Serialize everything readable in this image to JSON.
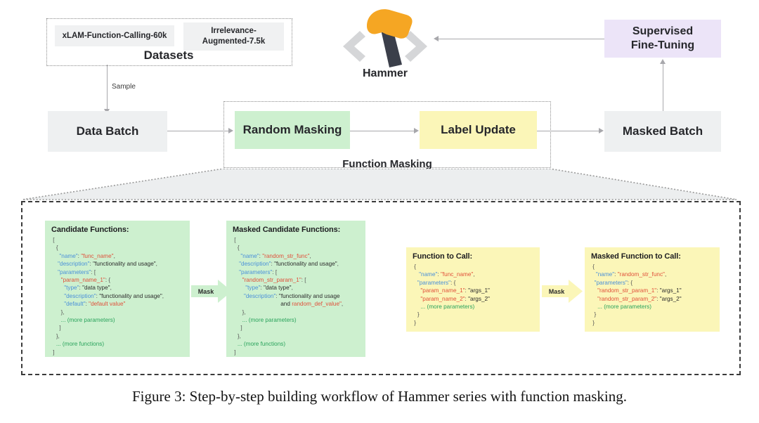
{
  "figure": {
    "caption": "Figure 3: Step-by-step building workflow of Hammer series with function masking."
  },
  "logo": {
    "name": "Hammer",
    "head_color": "#f5a623",
    "handle_color": "#3b3f4a",
    "bracket_color": "#d5d6d8"
  },
  "datasets_group": {
    "label": "Datasets",
    "items": [
      {
        "label": "xLAM-Function-Calling-60k"
      },
      {
        "label": "Irrelevance-\nAugmented-7.5k"
      }
    ]
  },
  "pipeline": {
    "sample_label": "Sample",
    "data_batch": {
      "label": "Data Batch",
      "color": "#eef0f1"
    },
    "random_masking": {
      "label": "Random Masking",
      "color": "#cdf0cf"
    },
    "label_update": {
      "label": "Label Update",
      "color": "#fbf6b8"
    },
    "masked_batch": {
      "label": "Masked Batch",
      "color": "#eef0f1"
    },
    "function_masking_label": "Function Masking",
    "supervised_fine_tuning": {
      "label": "Supervised\nFine-Tuning",
      "color": "#ece4f8"
    }
  },
  "detail": {
    "mask_arrow_1_label": "Mask",
    "mask_arrow_2_label": "Mask",
    "candidate_functions": {
      "title": "Candidate Functions:",
      "color": "#cdf0cf",
      "lines": [
        [
          [
            "b",
            " ["
          ]
        ],
        [
          [
            "b",
            "   {"
          ]
        ],
        [
          [
            "b",
            "     "
          ],
          [
            "k",
            "\"name\""
          ],
          [
            "b",
            ": "
          ],
          [
            "s",
            "\"func_name\""
          ],
          [
            "b",
            ","
          ]
        ],
        [
          [
            "b",
            "    "
          ],
          [
            "k",
            "\"description\""
          ],
          [
            "b",
            ": "
          ],
          [
            "p",
            "\"functionality and usage\""
          ],
          [
            "b",
            ","
          ]
        ],
        [
          [
            "b",
            "    "
          ],
          [
            "k",
            "\"parameters\""
          ],
          [
            "b",
            ": ["
          ]
        ],
        [
          [
            "b",
            "      "
          ],
          [
            "s",
            "\"param_name_1\""
          ],
          [
            "b",
            ": {"
          ]
        ],
        [
          [
            "b",
            "        "
          ],
          [
            "k",
            "\"type\""
          ],
          [
            "b",
            ": "
          ],
          [
            "p",
            "\"data type\""
          ],
          [
            "b",
            ","
          ]
        ],
        [
          [
            "b",
            "        "
          ],
          [
            "k",
            "\"description\""
          ],
          [
            "b",
            ": "
          ],
          [
            "p",
            "\"functionality and usage\""
          ],
          [
            "b",
            ","
          ]
        ],
        [
          [
            "b",
            "        "
          ],
          [
            "k",
            "\"default\""
          ],
          [
            "b",
            ": "
          ],
          [
            "s",
            "\"default value\""
          ]
        ],
        [
          [
            "b",
            "      },"
          ]
        ],
        [
          [
            "b",
            "      "
          ],
          [
            "g",
            "... (more parameters)"
          ]
        ],
        [
          [
            "b",
            "     ]"
          ]
        ],
        [
          [
            "b",
            "   },"
          ]
        ],
        [
          [
            "b",
            "   "
          ],
          [
            "g",
            "... (more functions)"
          ]
        ],
        [
          [
            "b",
            " ]"
          ]
        ]
      ]
    },
    "masked_candidate_functions": {
      "title": "Masked Candidate Functions:",
      "color": "#cdf0cf",
      "lines": [
        [
          [
            "b",
            " ["
          ]
        ],
        [
          [
            "b",
            "   {"
          ]
        ],
        [
          [
            "b",
            "     "
          ],
          [
            "k",
            "\"name\""
          ],
          [
            "b",
            ": "
          ],
          [
            "s",
            "\"random_str_func\""
          ],
          [
            "b",
            ","
          ]
        ],
        [
          [
            "b",
            "    "
          ],
          [
            "k",
            "\"description\""
          ],
          [
            "b",
            ": "
          ],
          [
            "p",
            "\"functionality and usage\""
          ],
          [
            "b",
            ","
          ]
        ],
        [
          [
            "b",
            "    "
          ],
          [
            "k",
            "\"parameters\""
          ],
          [
            "b",
            ": ["
          ]
        ],
        [
          [
            "b",
            "      "
          ],
          [
            "s",
            "\"random_str_param_1\""
          ],
          [
            "b",
            ": ["
          ]
        ],
        [
          [
            "b",
            "        "
          ],
          [
            "k",
            "\"type\""
          ],
          [
            "b",
            ": "
          ],
          [
            "p",
            "\"data type\""
          ],
          [
            "b",
            ","
          ]
        ],
        [
          [
            "b",
            "       "
          ],
          [
            "k",
            "\"description\""
          ],
          [
            "b",
            ": "
          ],
          [
            "p",
            "\"functionality and usage"
          ]
        ],
        [
          [
            "b",
            "                              "
          ],
          [
            "p",
            "and "
          ],
          [
            "s",
            "random_def_value\""
          ],
          [
            "b",
            ","
          ]
        ],
        [
          [
            "b",
            "      },"
          ]
        ],
        [
          [
            "b",
            "      "
          ],
          [
            "g",
            "... (more parameters)"
          ]
        ],
        [
          [
            "b",
            "     ]"
          ]
        ],
        [
          [
            "b",
            "   },"
          ]
        ],
        [
          [
            "b",
            "   "
          ],
          [
            "g",
            "... (more functions)"
          ]
        ],
        [
          [
            "b",
            " ]"
          ]
        ]
      ]
    },
    "function_to_call": {
      "title": "Function to Call:",
      "color": "#fbf6b8",
      "lines": [
        [
          [
            "b",
            " {"
          ]
        ],
        [
          [
            "b",
            "    "
          ],
          [
            "k",
            "\"name\""
          ],
          [
            "b",
            ": "
          ],
          [
            "s",
            "\"func_name\""
          ],
          [
            "b",
            ","
          ]
        ],
        [
          [
            "b",
            "   "
          ],
          [
            "k",
            "\"parameters\""
          ],
          [
            "b",
            ": {"
          ]
        ],
        [
          [
            "b",
            "     "
          ],
          [
            "s",
            "\"param_name_1\""
          ],
          [
            "b",
            ": "
          ],
          [
            "p",
            "\"args_1\""
          ]
        ],
        [
          [
            "b",
            "     "
          ],
          [
            "s",
            "\"param_name_2\""
          ],
          [
            "b",
            ": "
          ],
          [
            "p",
            "\"args_2\""
          ]
        ],
        [
          [
            "b",
            "     "
          ],
          [
            "g",
            "... (more parameters)"
          ]
        ],
        [
          [
            "b",
            "   }"
          ]
        ],
        [
          [
            "b",
            " }"
          ]
        ]
      ]
    },
    "masked_function_to_call": {
      "title": "Masked Function to Call:",
      "color": "#fbf6b8",
      "lines": [
        [
          [
            "b",
            " {"
          ]
        ],
        [
          [
            "b",
            "   "
          ],
          [
            "k",
            "\"name\""
          ],
          [
            "b",
            ": "
          ],
          [
            "s",
            "\"random_str_func\""
          ],
          [
            "b",
            ","
          ]
        ],
        [
          [
            "b",
            "  "
          ],
          [
            "k",
            "\"parameters\""
          ],
          [
            "b",
            ": {"
          ]
        ],
        [
          [
            "b",
            "    "
          ],
          [
            "s",
            "\"random_str_param_1\""
          ],
          [
            "b",
            ": "
          ],
          [
            "p",
            "\"args_1\""
          ]
        ],
        [
          [
            "b",
            "    "
          ],
          [
            "s",
            "\"random_str_param_2\""
          ],
          [
            "b",
            ": "
          ],
          [
            "p",
            "\"args_2\""
          ]
        ],
        [
          [
            "b",
            "    "
          ],
          [
            "g",
            "... (more parameters)"
          ]
        ],
        [
          [
            "b",
            "  }"
          ]
        ],
        [
          [
            "b",
            " }"
          ]
        ]
      ]
    }
  }
}
